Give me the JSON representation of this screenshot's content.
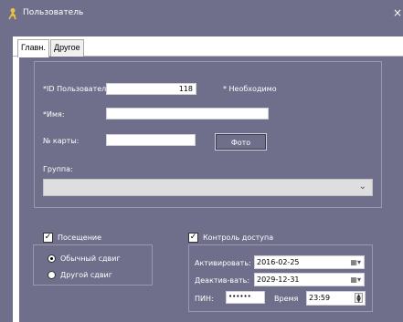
{
  "window": {
    "title": "Пользователь",
    "close_glyph": "×",
    "icon": "user-key-icon"
  },
  "tabs": [
    {
      "label": "Главн.",
      "active": true
    },
    {
      "label": "Другое",
      "active": false
    }
  ],
  "form": {
    "user_id_label": "*ID Пользовател",
    "user_id_value": "118",
    "required_note": "* Необходимо",
    "name_label": "*Имя:",
    "name_value": "",
    "card_label": "№ карты:",
    "card_value": "",
    "photo_button": "Фото",
    "group_label": "Группа:",
    "group_value": ""
  },
  "attendance": {
    "checkbox_label": "Посещение",
    "checked": true,
    "options": [
      {
        "label": "Обычный сдвиг",
        "selected": true
      },
      {
        "label": "Другой сдвиг",
        "selected": false
      }
    ]
  },
  "access": {
    "checkbox_label": "Контроль доступа",
    "checked": true,
    "activate_label": "Активировать:",
    "activate_value": "2016-02-25",
    "deactivate_label": "Деактив-вать:",
    "deactivate_value": "2029-12-31",
    "pin_label": "ПИН:",
    "pin_value": "••••••",
    "time_label": "Время",
    "time_value": "23:59"
  },
  "colors": {
    "background": "#6f6f8b",
    "accent_icon": "#f0c040"
  }
}
